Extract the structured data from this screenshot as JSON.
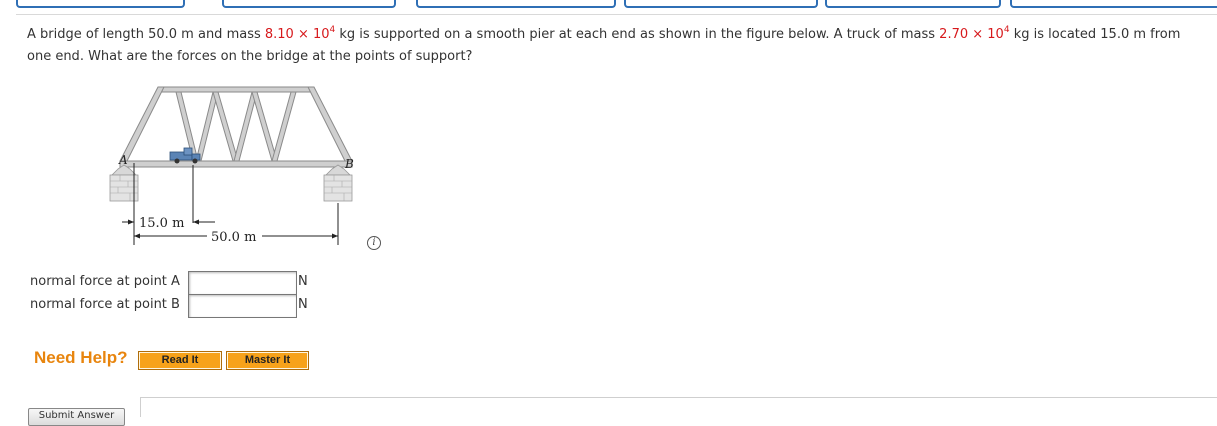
{
  "question": {
    "t1": "A bridge of length 50.0 m and mass ",
    "mass_bridge": "8.10 × 10",
    "mass_bridge_exp": "4",
    "t2": " kg is supported on a smooth pier at each end as shown in the figure below. A truck of mass ",
    "mass_truck": "2.70 × 10",
    "mass_truck_exp": "4",
    "t3": " kg is located 15.0 m from one end. What are the forces on the bridge at the points of support?"
  },
  "figure": {
    "label_a": "A",
    "label_b": "B",
    "dim_truck": "15.0 m",
    "dim_bridge": "50.0 m"
  },
  "fields": [
    {
      "label": "normal force at point A",
      "value": "",
      "unit": "N"
    },
    {
      "label": "normal force at point B",
      "value": "",
      "unit": "N"
    }
  ],
  "help": {
    "title": "Need Help?",
    "read_it": "Read It",
    "master_it": "Master It"
  },
  "submit_label": "Submit Answer",
  "colors": {
    "accent_red": "#d7191c",
    "help_orange": "#f7a21a",
    "tab_blue": "#2f6fb5"
  }
}
